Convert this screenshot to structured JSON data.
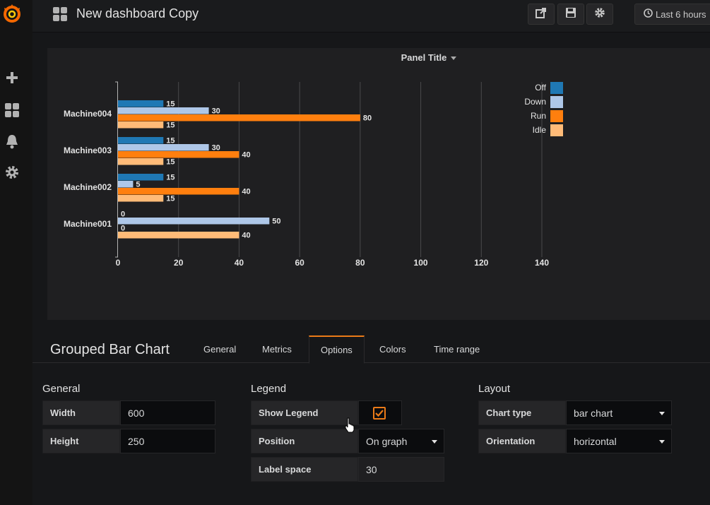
{
  "header": {
    "title": "New dashboard Copy",
    "time_range": "Last 6 hours"
  },
  "panel": {
    "title": "Panel Title"
  },
  "chart_data": {
    "type": "bar",
    "orientation": "horizontal",
    "categories": [
      "Machine004",
      "Machine003",
      "Machine002",
      "Machine001"
    ],
    "series": [
      {
        "name": "Off",
        "values": [
          15,
          15,
          15,
          0
        ],
        "color": "#1f78b4"
      },
      {
        "name": "Down",
        "values": [
          30,
          30,
          5,
          50
        ],
        "color": "#aec7e8"
      },
      {
        "name": "Run",
        "values": [
          80,
          40,
          40,
          0
        ],
        "color": "#ff7f0e"
      },
      {
        "name": "Idle",
        "values": [
          15,
          15,
          15,
          40
        ],
        "color": "#ffbb78"
      }
    ],
    "xlim": [
      0,
      140
    ],
    "ticks": [
      0,
      20,
      40,
      60,
      80,
      100,
      120,
      140
    ],
    "grid": true,
    "legend": "top-right"
  },
  "editor": {
    "title": "Grouped Bar Chart",
    "tabs": [
      "General",
      "Metrics",
      "Options",
      "Colors",
      "Time range"
    ],
    "active_tab": "Options"
  },
  "general": {
    "title": "General",
    "width_label": "Width",
    "width_value": "600",
    "height_label": "Height",
    "height_value": "250"
  },
  "legend": {
    "title": "Legend",
    "show_label": "Show Legend",
    "show_value": true,
    "position_label": "Position",
    "position_value": "On graph",
    "label_space_label": "Label space",
    "label_space_value": "30"
  },
  "layout": {
    "title": "Layout",
    "chart_type_label": "Chart type",
    "chart_type_value": "bar chart",
    "orientation_label": "Orientation",
    "orientation_value": "horizontal"
  },
  "colors": {
    "accent": "#eb7b18",
    "background": "#161719",
    "panel": "#1f1f21"
  }
}
